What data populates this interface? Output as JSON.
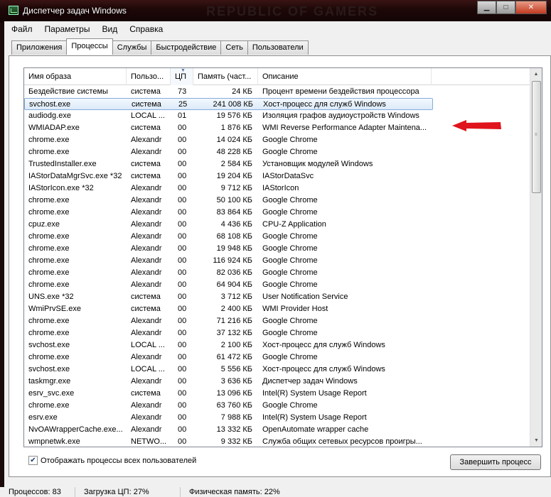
{
  "window": {
    "title": "Диспетчер задач Windows",
    "watermark": "REPUBLIC OF GAMERS",
    "min_glyph": "▁",
    "max_glyph": "□",
    "close_glyph": "✕"
  },
  "menu": [
    "Файл",
    "Параметры",
    "Вид",
    "Справка"
  ],
  "tabs": [
    "Приложения",
    "Процессы",
    "Службы",
    "Быстродействие",
    "Сеть",
    "Пользователи"
  ],
  "active_tab": "Процессы",
  "columns": {
    "name": "Имя образа",
    "user": "Пользо...",
    "cpu": "ЦП",
    "memory": "Память (част...",
    "description": "Описание",
    "sort_glyph": "▼"
  },
  "processes": [
    {
      "name": "Бездействие системы",
      "user": "система",
      "cpu": "73",
      "mem": "24 КБ",
      "desc": "Процент времени бездействия процессора"
    },
    {
      "name": "svchost.exe",
      "user": "система",
      "cpu": "25",
      "mem": "241 008 КБ",
      "desc": "Хост-процесс для служб Windows"
    },
    {
      "name": "audiodg.exe",
      "user": "LOCAL ...",
      "cpu": "01",
      "mem": "19 576 КБ",
      "desc": "Изоляция графов аудиоустройств Windows"
    },
    {
      "name": "WMIADAP.exe",
      "user": "система",
      "cpu": "00",
      "mem": "1 876 КБ",
      "desc": "WMI Reverse Performance Adapter Maintena..."
    },
    {
      "name": "chrome.exe",
      "user": "Alexandr",
      "cpu": "00",
      "mem": "14 024 КБ",
      "desc": "Google Chrome"
    },
    {
      "name": "chrome.exe",
      "user": "Alexandr",
      "cpu": "00",
      "mem": "48 228 КБ",
      "desc": "Google Chrome"
    },
    {
      "name": "TrustedInstaller.exe",
      "user": "система",
      "cpu": "00",
      "mem": "2 584 КБ",
      "desc": "Установщик модулей Windows"
    },
    {
      "name": "IAStorDataMgrSvc.exe *32",
      "user": "система",
      "cpu": "00",
      "mem": "19 204 КБ",
      "desc": "IAStorDataSvc"
    },
    {
      "name": "IAStorIcon.exe *32",
      "user": "Alexandr",
      "cpu": "00",
      "mem": "9 712 КБ",
      "desc": "IAStorIcon"
    },
    {
      "name": "chrome.exe",
      "user": "Alexandr",
      "cpu": "00",
      "mem": "50 100 КБ",
      "desc": "Google Chrome"
    },
    {
      "name": "chrome.exe",
      "user": "Alexandr",
      "cpu": "00",
      "mem": "83 864 КБ",
      "desc": "Google Chrome"
    },
    {
      "name": "cpuz.exe",
      "user": "Alexandr",
      "cpu": "00",
      "mem": "4 436 КБ",
      "desc": "CPU-Z Application"
    },
    {
      "name": "chrome.exe",
      "user": "Alexandr",
      "cpu": "00",
      "mem": "68 108 КБ",
      "desc": "Google Chrome"
    },
    {
      "name": "chrome.exe",
      "user": "Alexandr",
      "cpu": "00",
      "mem": "19 948 КБ",
      "desc": "Google Chrome"
    },
    {
      "name": "chrome.exe",
      "user": "Alexandr",
      "cpu": "00",
      "mem": "116 924 КБ",
      "desc": "Google Chrome"
    },
    {
      "name": "chrome.exe",
      "user": "Alexandr",
      "cpu": "00",
      "mem": "82 036 КБ",
      "desc": "Google Chrome"
    },
    {
      "name": "chrome.exe",
      "user": "Alexandr",
      "cpu": "00",
      "mem": "64 904 КБ",
      "desc": "Google Chrome"
    },
    {
      "name": "UNS.exe *32",
      "user": "система",
      "cpu": "00",
      "mem": "3 712 КБ",
      "desc": "User Notification Service"
    },
    {
      "name": "WmiPrvSE.exe",
      "user": "система",
      "cpu": "00",
      "mem": "2 400 КБ",
      "desc": "WMI Provider Host"
    },
    {
      "name": "chrome.exe",
      "user": "Alexandr",
      "cpu": "00",
      "mem": "71 216 КБ",
      "desc": "Google Chrome"
    },
    {
      "name": "chrome.exe",
      "user": "Alexandr",
      "cpu": "00",
      "mem": "37 132 КБ",
      "desc": "Google Chrome"
    },
    {
      "name": "svchost.exe",
      "user": "LOCAL ...",
      "cpu": "00",
      "mem": "2 100 КБ",
      "desc": "Хост-процесс для служб Windows"
    },
    {
      "name": "chrome.exe",
      "user": "Alexandr",
      "cpu": "00",
      "mem": "61 472 КБ",
      "desc": "Google Chrome"
    },
    {
      "name": "svchost.exe",
      "user": "LOCAL ...",
      "cpu": "00",
      "mem": "5 556 КБ",
      "desc": "Хост-процесс для служб Windows"
    },
    {
      "name": "taskmgr.exe",
      "user": "Alexandr",
      "cpu": "00",
      "mem": "3 636 КБ",
      "desc": "Диспетчер задач Windows"
    },
    {
      "name": "esrv_svc.exe",
      "user": "система",
      "cpu": "00",
      "mem": "13 096 КБ",
      "desc": "Intel(R) System Usage Report"
    },
    {
      "name": "chrome.exe",
      "user": "Alexandr",
      "cpu": "00",
      "mem": "63 760 КБ",
      "desc": "Google Chrome"
    },
    {
      "name": "esrv.exe",
      "user": "Alexandr",
      "cpu": "00",
      "mem": "7 988 КБ",
      "desc": "Intel(R) System Usage Report"
    },
    {
      "name": "NvOAWrapperCache.exe...",
      "user": "Alexandr",
      "cpu": "00",
      "mem": "13 332 КБ",
      "desc": "OpenAutomate wrapper cache"
    },
    {
      "name": "wmpnetwk.exe",
      "user": "NETWO...",
      "cpu": "00",
      "mem": "9 332 КБ",
      "desc": "Служба общих сетевых ресурсов проигры..."
    }
  ],
  "selected_index": 1,
  "scroll": {
    "up_glyph": "▲",
    "down_glyph": "▼",
    "grip": "≡"
  },
  "show_all": {
    "label": "Отображать процессы всех пользователей",
    "checked": true,
    "check_glyph": "✔"
  },
  "end_process_label": "Завершить процесс",
  "annotation_color": "#e0141c",
  "status": {
    "processes": "Процессов: 83",
    "cpu": "Загрузка ЦП: 27%",
    "memory": "Физическая память: 22%"
  }
}
